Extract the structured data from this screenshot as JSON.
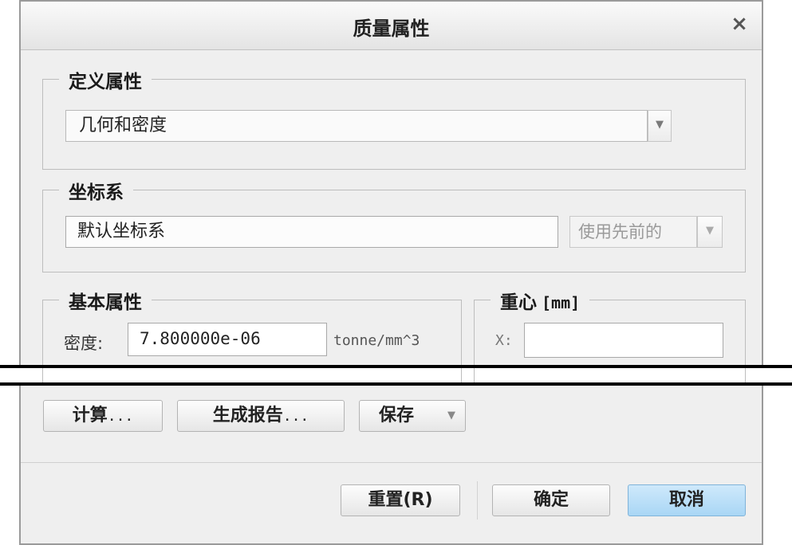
{
  "dialog": {
    "title": "质量属性",
    "close_glyph": "×"
  },
  "define_properties": {
    "legend": "定义属性",
    "selected": "几何和密度"
  },
  "coordinate_system": {
    "legend": "坐标系",
    "value": "默认坐标系",
    "mode": "使用先前的"
  },
  "basic_properties": {
    "legend": "基本属性",
    "density_label": "密度:",
    "density_value": "7.800000e-06",
    "density_unit": "tonne/mm^3"
  },
  "center_of_gravity": {
    "legend": "重心",
    "unit": "[mm]",
    "x_label": "X:",
    "x_value": ""
  },
  "actions": {
    "compute": "计算",
    "report": "生成报告",
    "save": "保存",
    "ellipsis": "..."
  },
  "footer": {
    "reset": "重置(R)",
    "ok": "确定",
    "cancel": "取消"
  },
  "icons": {
    "dropdown": "chevron-down-icon",
    "close": "close-icon"
  },
  "colors": {
    "primary_button": "#a9d6f5",
    "dialog_bg": "#efefef"
  }
}
